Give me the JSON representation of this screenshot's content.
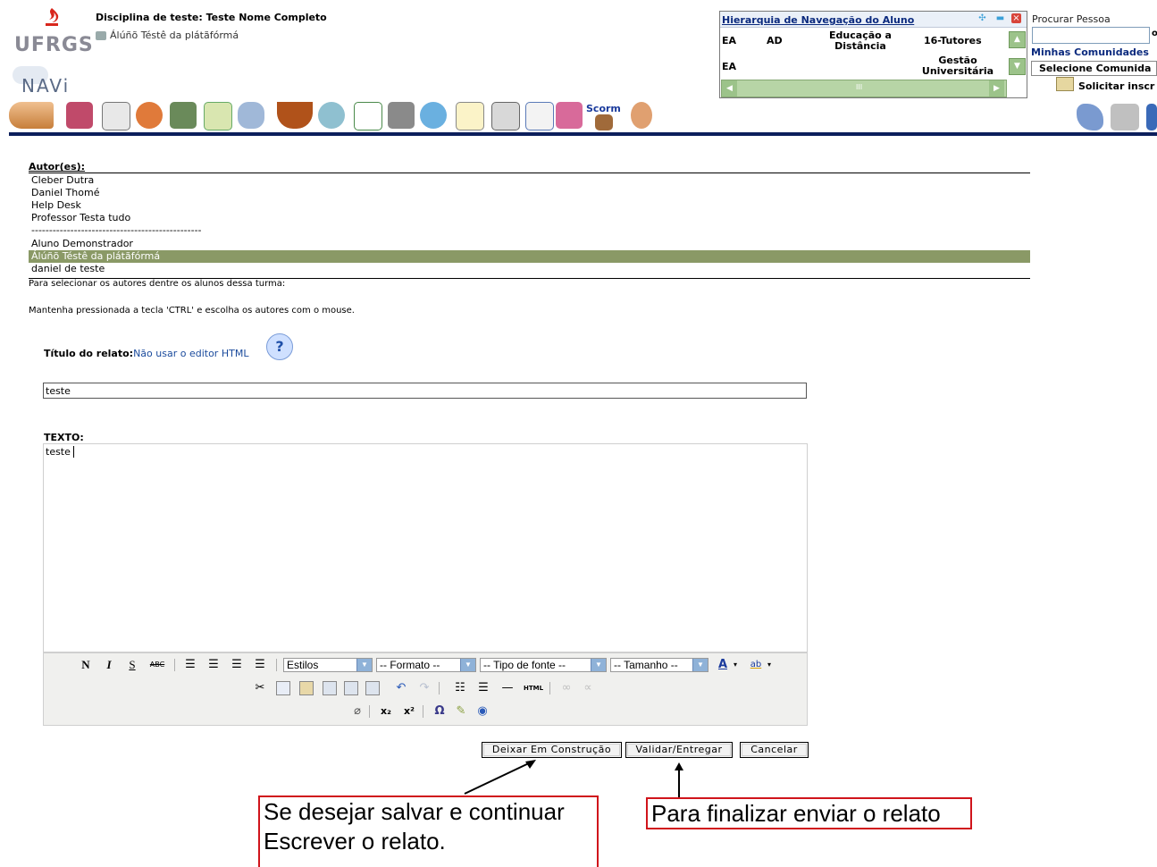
{
  "header": {
    "ufrgs_logo": "UFRGS",
    "navi_logo": "NAVi",
    "course_title": "Disciplina de teste: Teste Nome Completo",
    "user_name": "Álúñõ Téstê da plátãfórmá"
  },
  "hierarchy": {
    "title": "Hierarquia de Navegação do Aluno",
    "rows": [
      {
        "c1": "EA",
        "c2": "AD",
        "c3": "Educação a Distância",
        "c4": "16-Tutores"
      },
      {
        "c1": "EA",
        "c2": "",
        "c3": "",
        "c4": "Gestão Universitária"
      }
    ],
    "scroll_grip": "III"
  },
  "right_panel": {
    "procurar_label": "Procurar Pessoa",
    "go_label": "o",
    "comunidades_label": "Minhas Comunidades",
    "selecione_value": "Selecione Comunida",
    "solicitar_label": "Solicitar inscr"
  },
  "toolbar": {
    "scorm_label": "Scorm",
    "icons": [
      "handshake-icon",
      "book-icon",
      "pages-icon",
      "people-icon",
      "notebook-icon",
      "checklist-icon",
      "newspaper-icon",
      "coffee-icon",
      "cd-icon",
      "edit-icon",
      "mail-icon",
      "pencil-icon",
      "notepad-icon",
      "document-icon",
      "checkbox-icon",
      "users-icon",
      "scorm-icon",
      "group-icon"
    ]
  },
  "authors": {
    "label": "Autor(es):",
    "items": [
      "Cleber Dutra",
      "Daniel Thomé",
      "Help Desk",
      "Professor Testa tudo",
      "------------------------------------------------",
      "Aluno Demonstrador",
      "Álúñõ Téstê da plátãfórmá",
      "daniel de teste"
    ],
    "selected_index": 6,
    "help_line_1": "Para selecionar os autores dentre os alunos dessa turma:",
    "help_line_2": "Mantenha pressionada a tecla 'CTRL' e escolha os autores com o mouse."
  },
  "form": {
    "title_label": "Título do relato:",
    "html_editor_link": "Não usar o editor HTML",
    "help_icon": "?",
    "title_value": "teste",
    "text_label": "TEXTO:",
    "text_value": "teste"
  },
  "editor": {
    "bold": "N",
    "italic": "I",
    "strike": "S",
    "spell": "ABC",
    "styles": "Estilos",
    "format": "-- Formato --",
    "font": "-- Tipo de fonte --",
    "size": "-- Tamanho --",
    "font_color": "A",
    "highlight": "ab",
    "html_btn": "HTML",
    "omega": "Ω",
    "sub": "x₂",
    "sup": "x²"
  },
  "buttons": {
    "draft": "Deixar Em Construção",
    "submit": "Validar/Entregar",
    "cancel": "Cancelar"
  },
  "annotations": {
    "note_save_1": "Se desejar salvar e continuar",
    "note_save_2": "Escrever o relato.",
    "note_submit": "Para finalizar enviar o relato"
  },
  "colors": {
    "selection": "#8a9966",
    "nav_bar": "#0c1f5c",
    "annotation_border": "#d0141b"
  }
}
